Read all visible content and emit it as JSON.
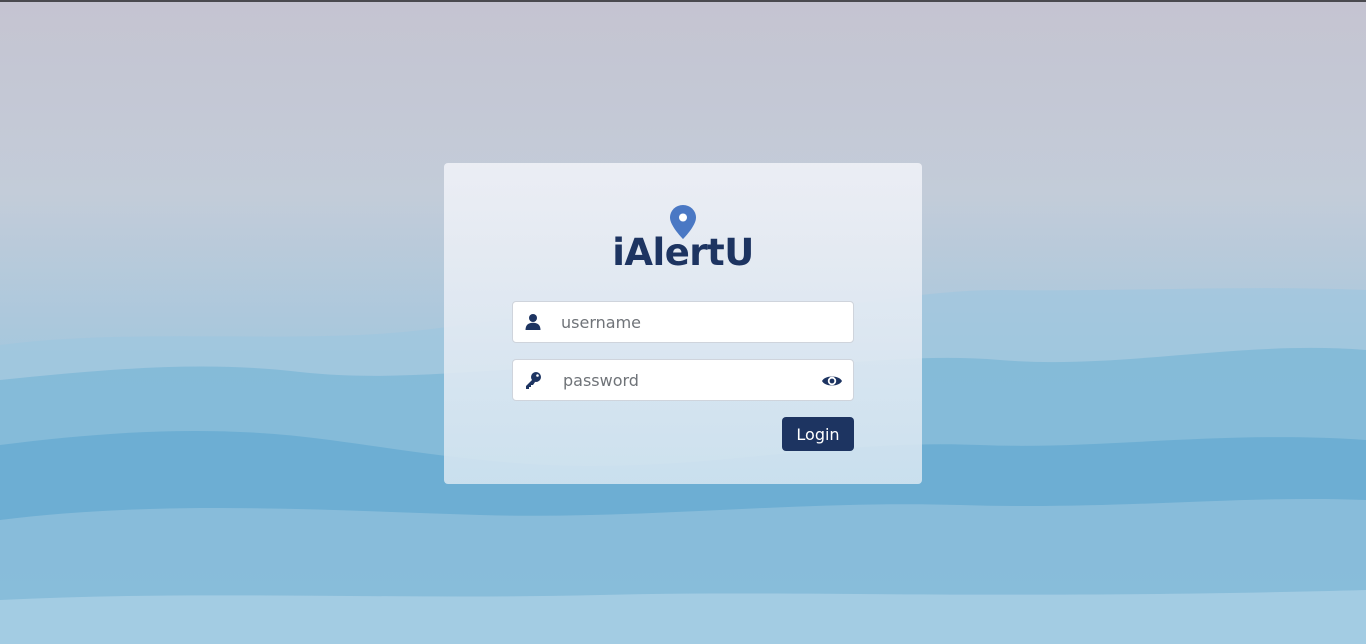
{
  "app": {
    "brand_name": "iAlertU"
  },
  "login_form": {
    "username_placeholder": "username",
    "password_placeholder": "password",
    "login_label": "Login"
  },
  "icons": {
    "logo": "map-pin-icon",
    "username": "user-icon",
    "password": "key-icon",
    "toggle_password": "eye-icon"
  },
  "colors": {
    "brand": "#1d3461",
    "pin": "#4a78c4",
    "button": "#1d3461",
    "button_text": "#ffffff"
  }
}
